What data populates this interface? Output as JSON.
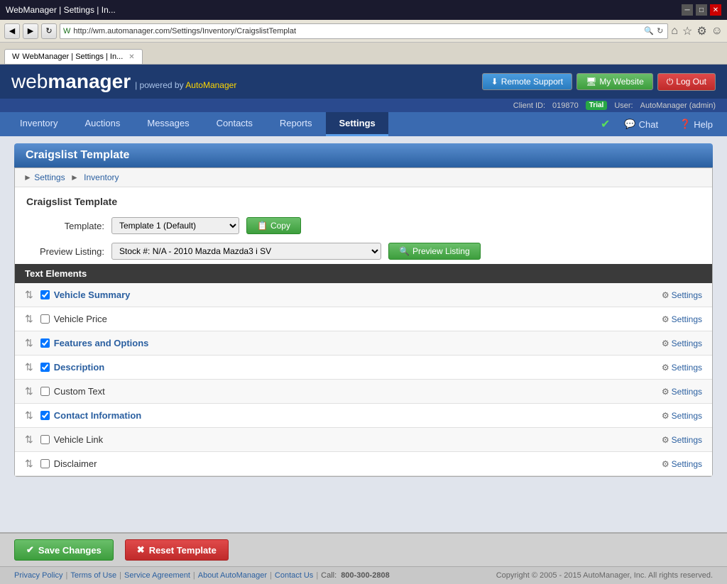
{
  "browser": {
    "address": "http://wm.automanager.com/Settings/Inventory/CraigslistTemplat",
    "tab_title": "WebManager | Settings | In...",
    "tab_icon": "W"
  },
  "header": {
    "logo_web": "web",
    "logo_manager": "manager",
    "powered_by": "powered by",
    "brand": "AutoManager",
    "buttons": {
      "remote_support": "Remote Support",
      "my_website": "My Website",
      "log_out": "Log Out"
    },
    "client_id_label": "Client ID:",
    "client_id": "019870",
    "trial_label": "Trial",
    "user_label": "User:",
    "user_value": "AutoManager (admin)"
  },
  "nav": {
    "items": [
      {
        "label": "Inventory",
        "active": false
      },
      {
        "label": "Auctions",
        "active": false
      },
      {
        "label": "Messages",
        "active": false
      },
      {
        "label": "Contacts",
        "active": false
      },
      {
        "label": "Reports",
        "active": false
      },
      {
        "label": "Settings",
        "active": true
      }
    ],
    "right_items": [
      {
        "label": "Chat",
        "icon": "💬"
      },
      {
        "label": "Help",
        "icon": "❓"
      }
    ]
  },
  "page": {
    "title": "Craigslist Template",
    "breadcrumb": {
      "settings": "Settings",
      "inventory": "Inventory"
    },
    "section_title": "Craigslist Template",
    "template_label": "Template:",
    "template_value": "Template 1 (Default)",
    "copy_label": "Copy",
    "preview_listing_label": "Preview Listing:",
    "preview_listing_value": "Stock #: N/A - 2010 Mazda Mazda3 i SV",
    "preview_button": "Preview Listing",
    "text_elements_header": "Text Elements",
    "elements": [
      {
        "id": 1,
        "name": "Vehicle Summary",
        "checked": true,
        "highlighted": true
      },
      {
        "id": 2,
        "name": "Vehicle Price",
        "checked": false,
        "highlighted": false
      },
      {
        "id": 3,
        "name": "Features and Options",
        "checked": true,
        "highlighted": true
      },
      {
        "id": 4,
        "name": "Description",
        "checked": true,
        "highlighted": true
      },
      {
        "id": 5,
        "name": "Custom Text",
        "checked": false,
        "highlighted": false
      },
      {
        "id": 6,
        "name": "Contact Information",
        "checked": true,
        "highlighted": true
      },
      {
        "id": 7,
        "name": "Vehicle Link",
        "checked": false,
        "highlighted": false
      },
      {
        "id": 8,
        "name": "Disclaimer",
        "checked": false,
        "highlighted": false
      }
    ],
    "settings_label": "Settings"
  },
  "footer": {
    "save_changes": "Save Changes",
    "reset_template": "Reset Template"
  },
  "page_footer": {
    "privacy_policy": "Privacy Policy",
    "terms_of_use": "Terms of Use",
    "service_agreement": "Service Agreement",
    "about_automanager": "About AutoManager",
    "contact_us": "Contact Us",
    "call_label": "Call:",
    "phone": "800-300-2808",
    "copyright": "Copyright © 2005 - 2015 AutoManager, Inc.  All rights reserved."
  }
}
